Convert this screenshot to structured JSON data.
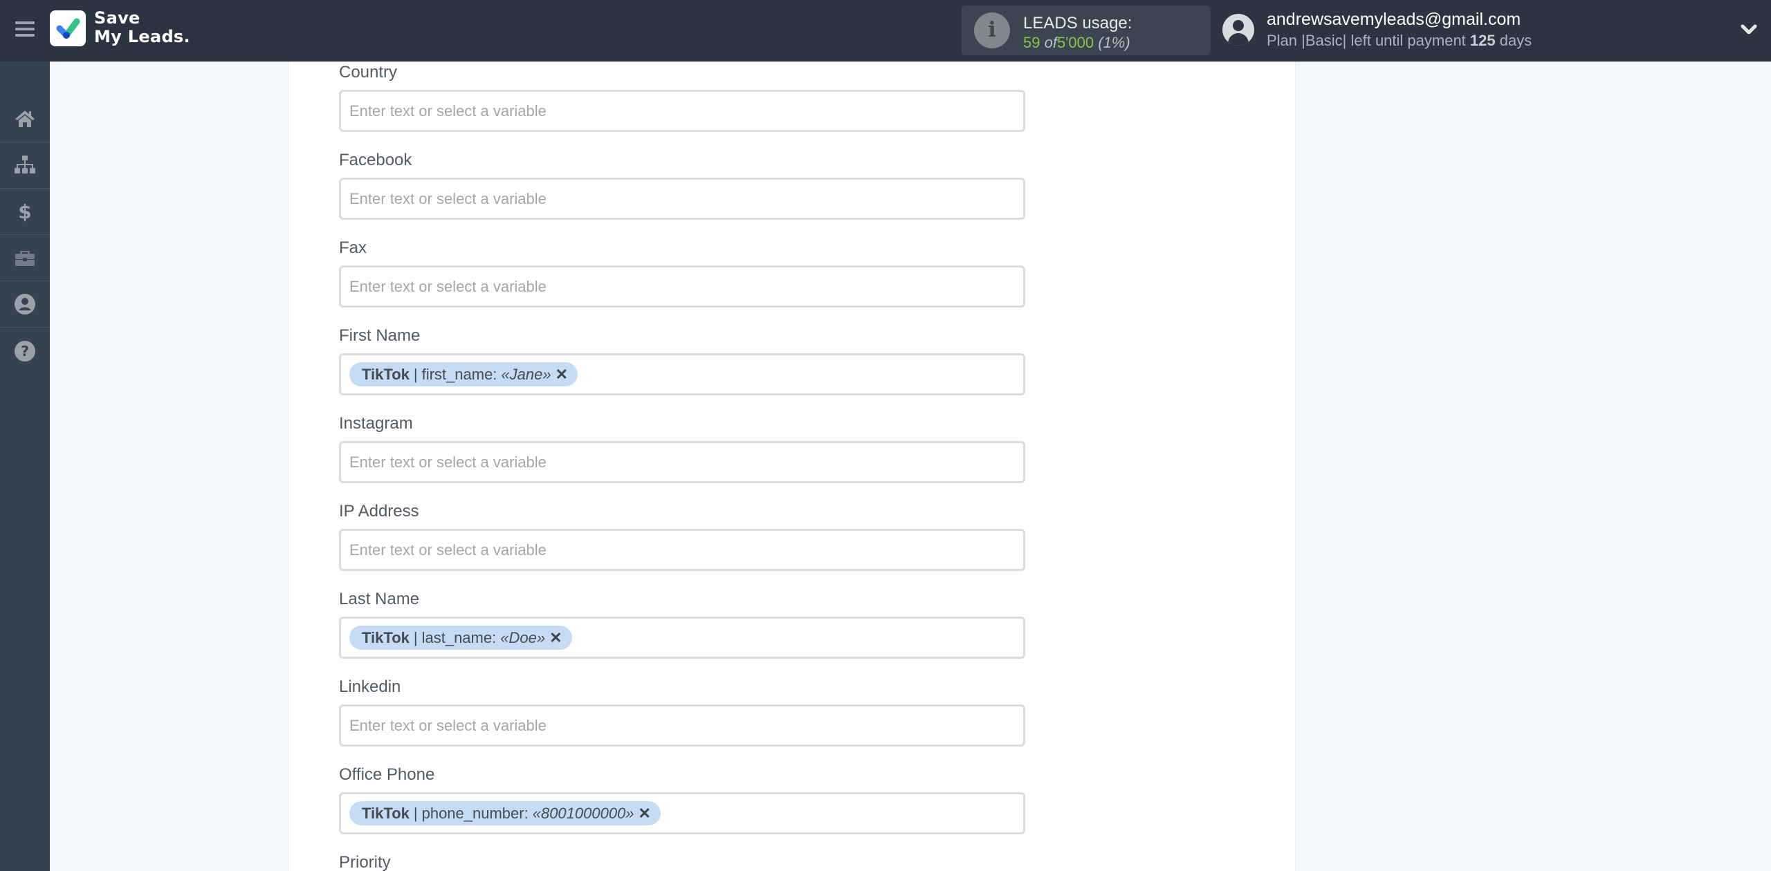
{
  "header": {
    "menu_icon": "hamburger-icon",
    "logo": {
      "line1": "Save",
      "line2": "My Leads."
    },
    "usage": {
      "title": "LEADS usage:",
      "used": "59",
      "of_word": "of",
      "total": "5'000",
      "percent": "(1%)",
      "icon": "info-icon"
    },
    "user": {
      "email": "andrewsavemyleads@gmail.com",
      "plan_prefix": "Plan |Basic| left until payment",
      "days": "125",
      "days_suffix": "days",
      "avatar_icon": "user-avatar-icon",
      "dropdown_icon": "chevron-down-icon"
    },
    "colors": {
      "header_bg": "#2b3440",
      "sidebar_bg": "#374250",
      "usage_green": "#8bc34a",
      "chip_bg": "#c6dcf4"
    }
  },
  "sidebar": {
    "items": [
      {
        "name": "home",
        "icon": "home-icon"
      },
      {
        "name": "connections",
        "icon": "sitemap-icon"
      },
      {
        "name": "billing",
        "icon": "dollar-icon"
      },
      {
        "name": "tools",
        "icon": "briefcase-icon"
      },
      {
        "name": "account",
        "icon": "user-circle-icon"
      },
      {
        "name": "help",
        "icon": "question-circle-icon"
      }
    ]
  },
  "form": {
    "placeholder": "Enter text or select a variable",
    "fields": [
      {
        "label": "Country",
        "value": null
      },
      {
        "label": "Facebook",
        "value": null
      },
      {
        "label": "Fax",
        "value": null
      },
      {
        "label": "First Name",
        "value": {
          "source": "TikTok",
          "sep": "|",
          "field": "first_name:",
          "sample": "«Jane»"
        }
      },
      {
        "label": "Instagram",
        "value": null
      },
      {
        "label": "IP Address",
        "value": null
      },
      {
        "label": "Last Name",
        "value": {
          "source": "TikTok",
          "sep": "|",
          "field": "last_name:",
          "sample": "«Doe»"
        }
      },
      {
        "label": "Linkedin",
        "value": null
      },
      {
        "label": "Office Phone",
        "value": {
          "source": "TikTok",
          "sep": "|",
          "field": "phone_number:",
          "sample": "«8001000000»"
        }
      },
      {
        "label": "Priority",
        "value": null
      }
    ]
  }
}
